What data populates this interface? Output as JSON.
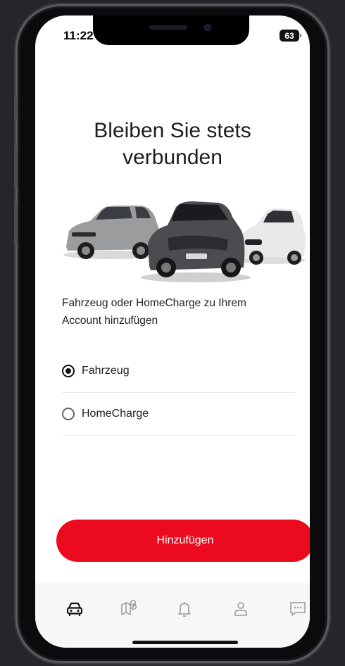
{
  "status_bar": {
    "time": "11:22",
    "battery": "63"
  },
  "page": {
    "title_line1": "Bleiben Sie stets",
    "title_line2": "verbunden",
    "subtitle": "Fahrzeug oder HomeCharge zu Ihrem Account hinzufügen"
  },
  "options": [
    {
      "label": "Fahrzeug",
      "selected": true
    },
    {
      "label": "HomeCharge",
      "selected": false
    }
  ],
  "cta": {
    "label": "Hinzufügen"
  },
  "tabbar": {
    "items": [
      {
        "icon": "car-icon",
        "active": true
      },
      {
        "icon": "map-pin-icon",
        "active": false
      },
      {
        "icon": "bell-icon",
        "active": false
      },
      {
        "icon": "user-icon",
        "active": false
      },
      {
        "icon": "chat-icon",
        "active": false
      }
    ]
  },
  "colors": {
    "accent": "#eb0a1e",
    "background": "#ffffff",
    "tabbar": "#f7f7f7"
  }
}
